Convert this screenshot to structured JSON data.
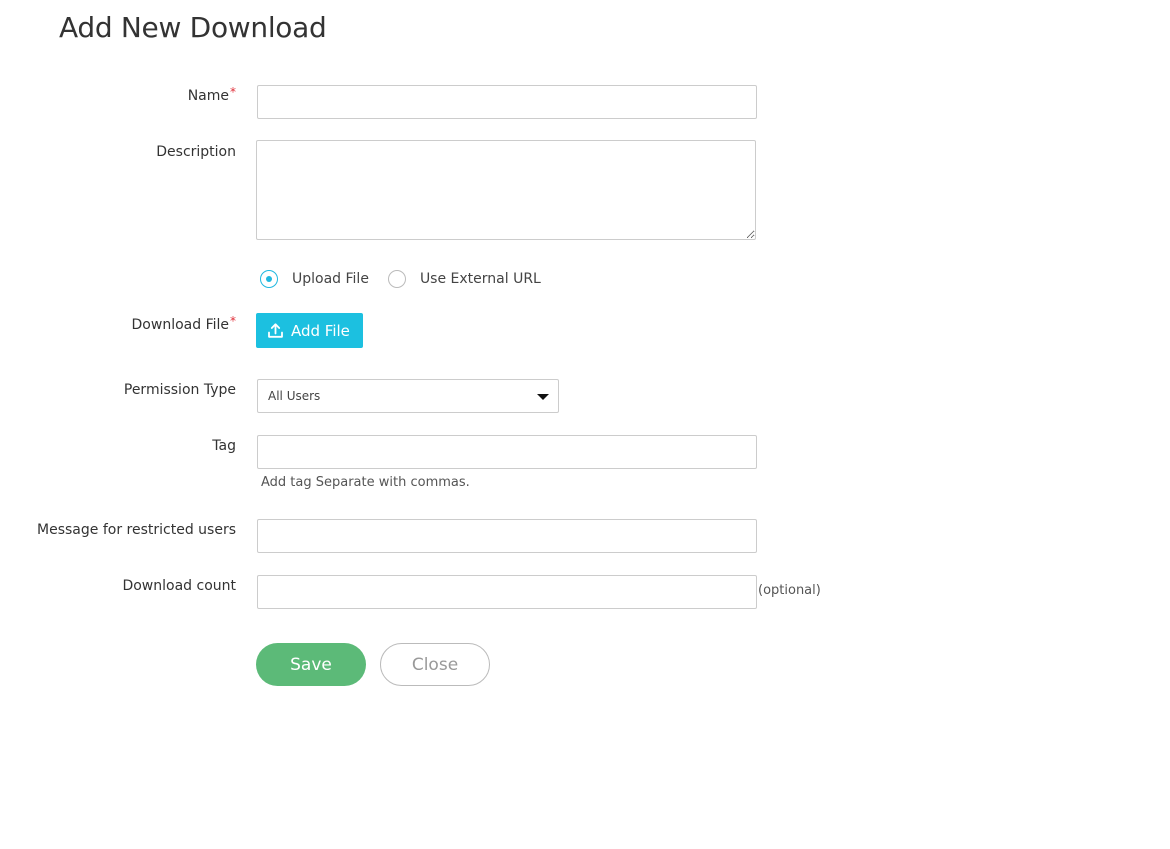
{
  "page": {
    "title": "Add New Download"
  },
  "form": {
    "name": {
      "label": "Name",
      "required_mark": "*",
      "value": ""
    },
    "description": {
      "label": "Description",
      "value": ""
    },
    "source": {
      "options": [
        "Upload File",
        "Use External URL"
      ],
      "selected": "Upload File"
    },
    "download_file": {
      "label": "Download File",
      "required_mark": "*",
      "button_label": "Add File",
      "icon": "upload-icon"
    },
    "permission_type": {
      "label": "Permission Type",
      "selected": "All Users",
      "icon": "caret-down-icon"
    },
    "tag": {
      "label": "Tag",
      "value": "",
      "helper": "Add tag Separate with commas."
    },
    "restricted_message": {
      "label": "Message for restricted users",
      "value": ""
    },
    "download_count": {
      "label": "Download count",
      "value": "",
      "suffix": "(optional)"
    }
  },
  "actions": {
    "save_label": "Save",
    "close_label": "Close"
  },
  "colors": {
    "accent": "#1cc0e0",
    "save": "#5cba78",
    "required": "#e0303a"
  }
}
